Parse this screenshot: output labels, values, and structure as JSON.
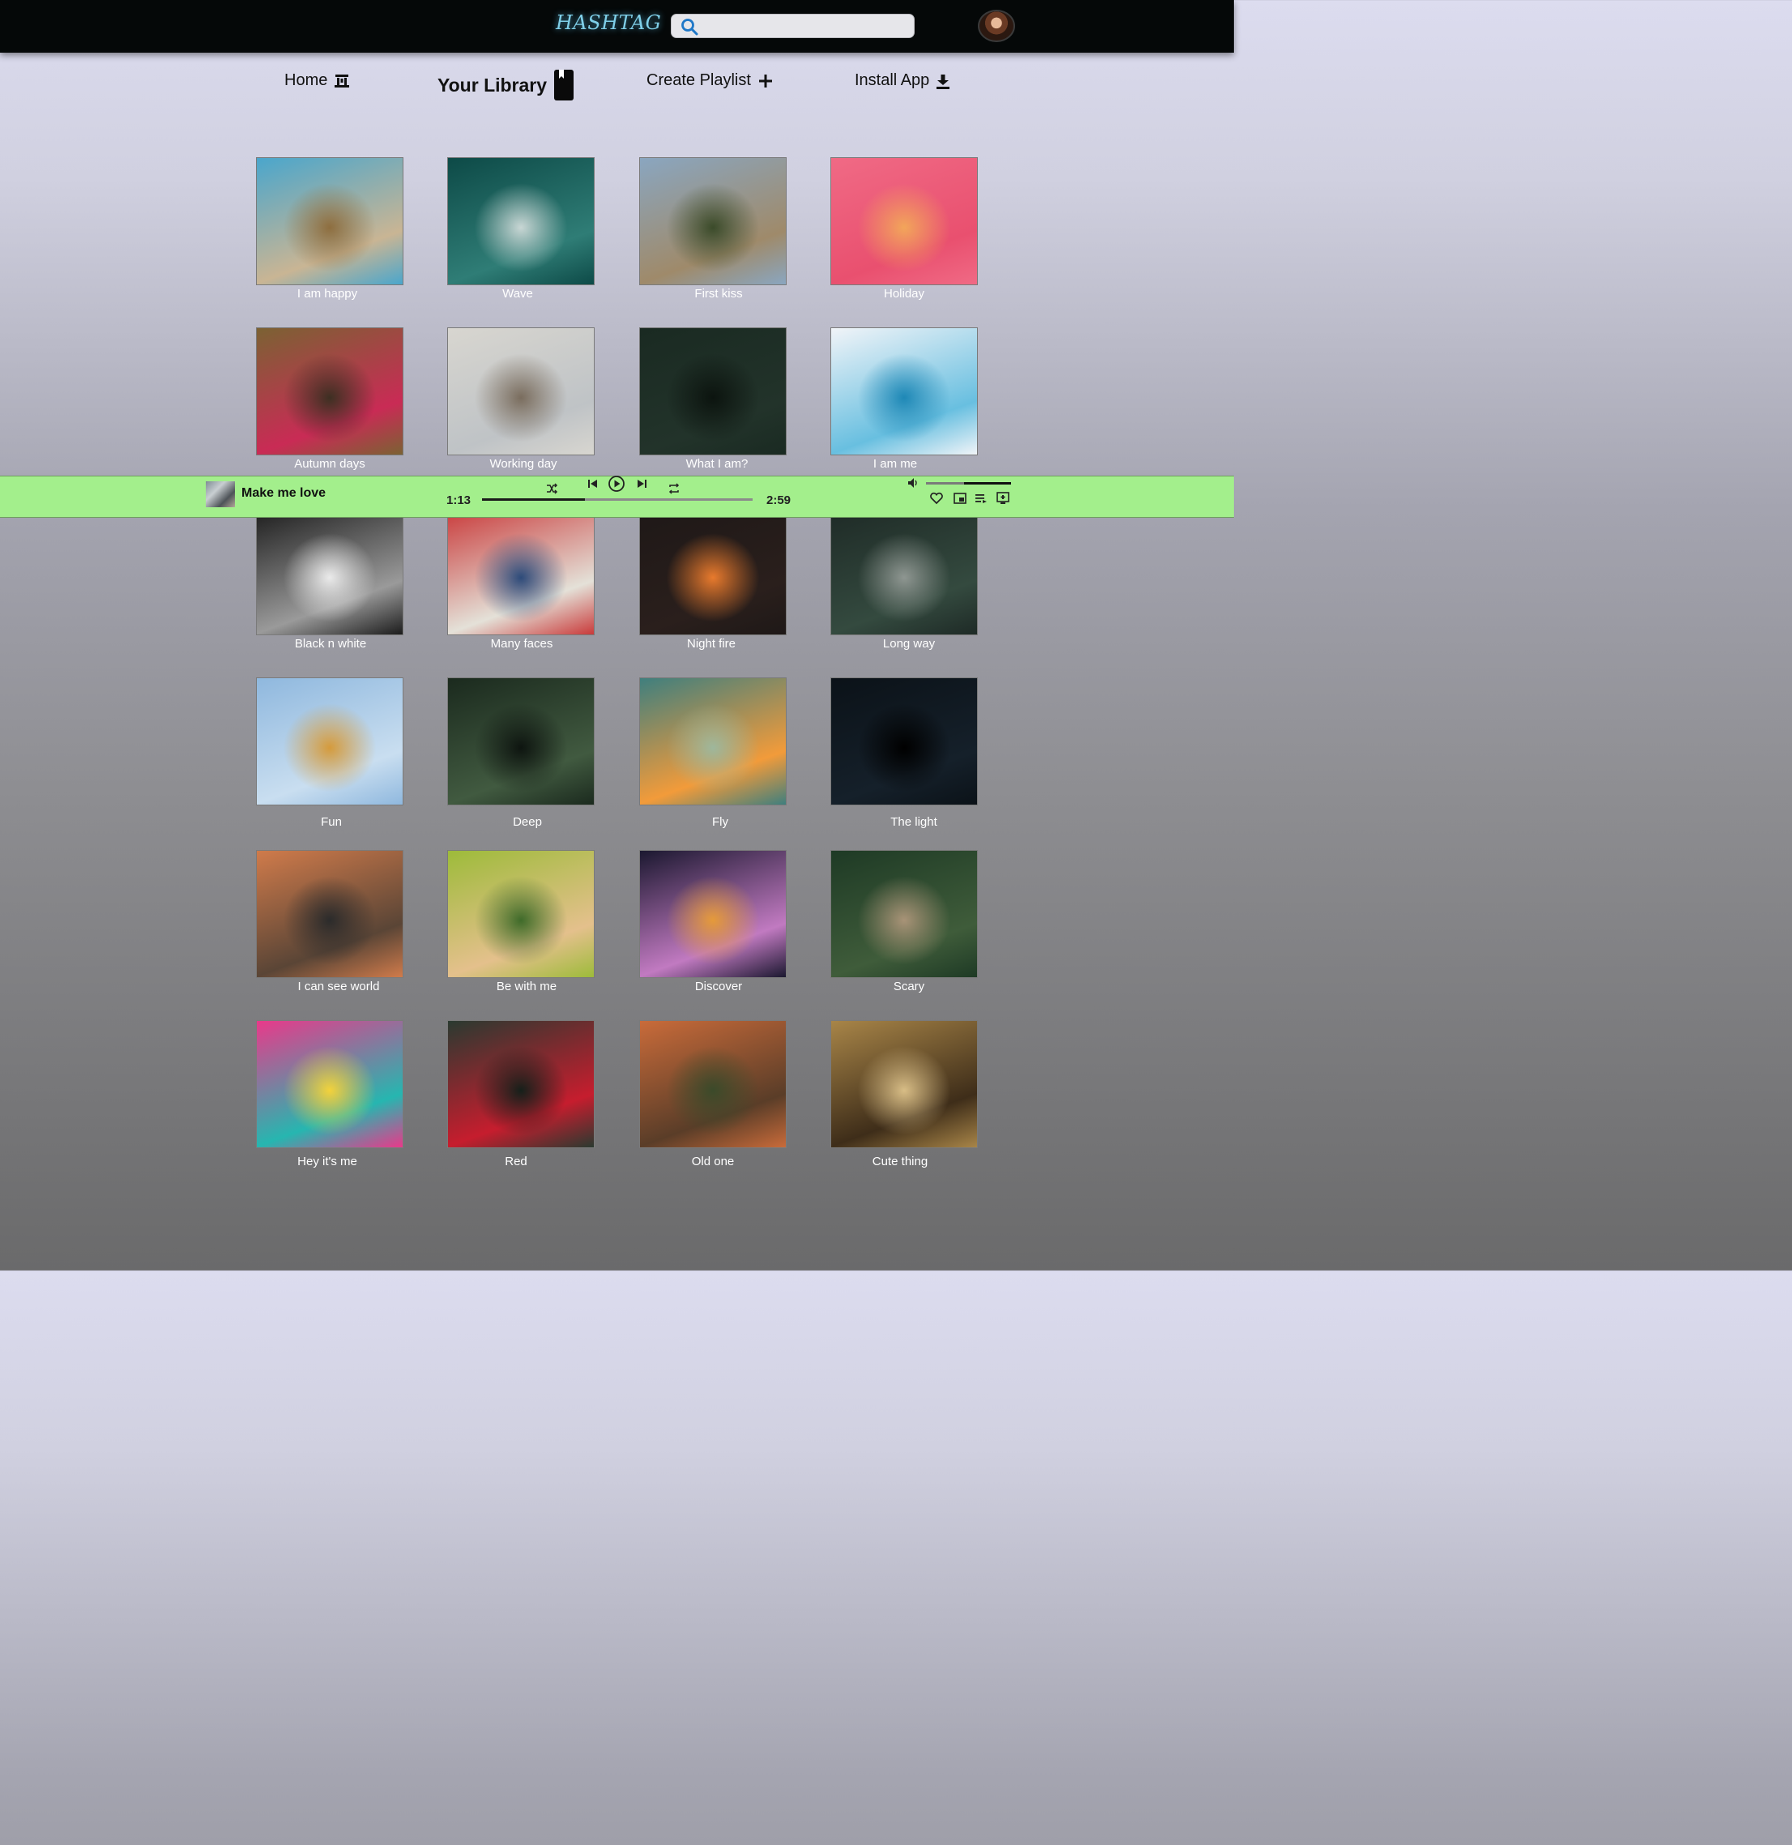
{
  "app": {
    "logo": "HASHTAG",
    "search": {
      "placeholder": "",
      "value": ""
    }
  },
  "nav": [
    {
      "label": "Home",
      "icon": "home-icon"
    },
    {
      "label": "Your Library",
      "icon": "library-icon",
      "active": true
    },
    {
      "label": "Create Playlist",
      "icon": "plus-icon"
    },
    {
      "label": "Install App",
      "icon": "download-icon"
    }
  ],
  "playlists": [
    {
      "title": "I am happy",
      "colors": [
        "#4aa6cc",
        "#c9b594",
        "#8e6e3f"
      ]
    },
    {
      "title": "Wave",
      "colors": [
        "#0d4a47",
        "#2f7d76",
        "#c8d6d4"
      ]
    },
    {
      "title": "First kiss",
      "colors": [
        "#8aa6c0",
        "#9f8a6a",
        "#3b4b2a"
      ]
    },
    {
      "title": "Holiday",
      "colors": [
        "#f06a85",
        "#e9506f",
        "#f2a55a"
      ]
    },
    {
      "title": "Autumn days",
      "colors": [
        "#7b6233",
        "#c92b55",
        "#3d2f22"
      ]
    },
    {
      "title": "Working day",
      "colors": [
        "#d8d6d0",
        "#bfc3c6",
        "#7a6d5e"
      ]
    },
    {
      "title": "What I am?",
      "colors": [
        "#1a2a22",
        "#22332a",
        "#0c140f"
      ]
    },
    {
      "title": "I am me",
      "colors": [
        "#f1f4f8",
        "#68bfe0",
        "#1e88b6"
      ]
    },
    {
      "title": "Black n white",
      "colors": [
        "#1c1c1c",
        "#9a9a9a",
        "#eaeaea"
      ]
    },
    {
      "title": "Many faces",
      "colors": [
        "#c93a3a",
        "#e4e1d8",
        "#2d4b7a"
      ]
    },
    {
      "title": "Night fire",
      "colors": [
        "#1e1817",
        "#2a1f1c",
        "#e87a2d"
      ]
    },
    {
      "title": "Long way",
      "colors": [
        "#1e2a26",
        "#344a3f",
        "#8e9691"
      ]
    },
    {
      "title": "Fun",
      "colors": [
        "#8fb8de",
        "#c9def0",
        "#d59b3c"
      ]
    },
    {
      "title": "Deep",
      "colors": [
        "#1b2a1e",
        "#415a40",
        "#0e1510"
      ]
    },
    {
      "title": "Fly",
      "colors": [
        "#3f7f7e",
        "#f29b3a",
        "#9eb79c"
      ]
    },
    {
      "title": "The light",
      "colors": [
        "#0b1218",
        "#15202a",
        "#000000"
      ]
    },
    {
      "title": "I can see world",
      "colors": [
        "#d07b4b",
        "#5a4536",
        "#2b2b2b"
      ]
    },
    {
      "title": "Be with me",
      "colors": [
        "#9dbb3a",
        "#e4c08c",
        "#3f6b2a"
      ]
    },
    {
      "title": "Discover",
      "colors": [
        "#1b1830",
        "#c17ac1",
        "#e59a3a"
      ]
    },
    {
      "title": "Scary",
      "colors": [
        "#1e3a25",
        "#3f5c3a",
        "#a89377"
      ]
    },
    {
      "title": "Hey it's me",
      "colors": [
        "#e9398a",
        "#26b6b0",
        "#f3d23b"
      ]
    },
    {
      "title": "Red",
      "colors": [
        "#2a3a30",
        "#c61d2e",
        "#15201a"
      ]
    },
    {
      "title": "Old one",
      "colors": [
        "#c96b3a",
        "#5a3d28",
        "#3b4a2a"
      ]
    },
    {
      "title": "Cute thing",
      "colors": [
        "#a88548",
        "#3e2d19",
        "#d8bd86"
      ]
    }
  ],
  "player": {
    "track": "Make me love",
    "elapsed": "1:13",
    "duration": "2:59",
    "progress": 0.38,
    "volume": 0.55,
    "accent": "#a3ef8c"
  }
}
